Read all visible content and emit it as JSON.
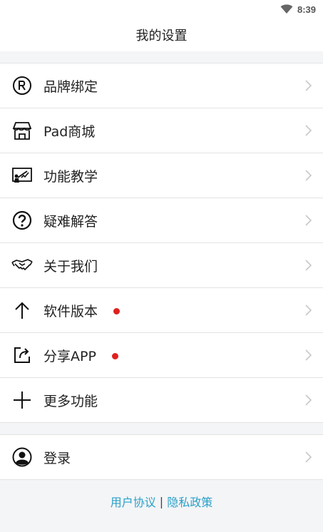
{
  "status_bar": {
    "time": "8:39",
    "wifi_icon": "wifi-icon"
  },
  "header": {
    "title": "我的设置"
  },
  "menu": {
    "items": [
      {
        "label": "品牌绑定",
        "icon": "registered-icon",
        "badge": false
      },
      {
        "label": "Pad商城",
        "icon": "store-icon",
        "badge": false
      },
      {
        "label": "功能教学",
        "icon": "teaching-board-icon",
        "badge": false
      },
      {
        "label": "疑难解答",
        "icon": "question-icon",
        "badge": false
      },
      {
        "label": "关于我们",
        "icon": "handshake-icon",
        "badge": false
      },
      {
        "label": "软件版本",
        "icon": "arrow-up-icon",
        "badge": true
      },
      {
        "label": "分享APP",
        "icon": "share-icon",
        "badge": true
      },
      {
        "label": "更多功能",
        "icon": "plus-icon",
        "badge": false
      }
    ]
  },
  "account": {
    "login_label": "登录",
    "icon": "user-avatar-icon"
  },
  "footer": {
    "user_agreement": "用户协议",
    "separator": "|",
    "privacy_policy": "隐私政策"
  },
  "colors": {
    "link": "#2aa0c8",
    "badge": "#e02020",
    "background": "#f4f5f7",
    "divider": "#e3e3e3"
  }
}
